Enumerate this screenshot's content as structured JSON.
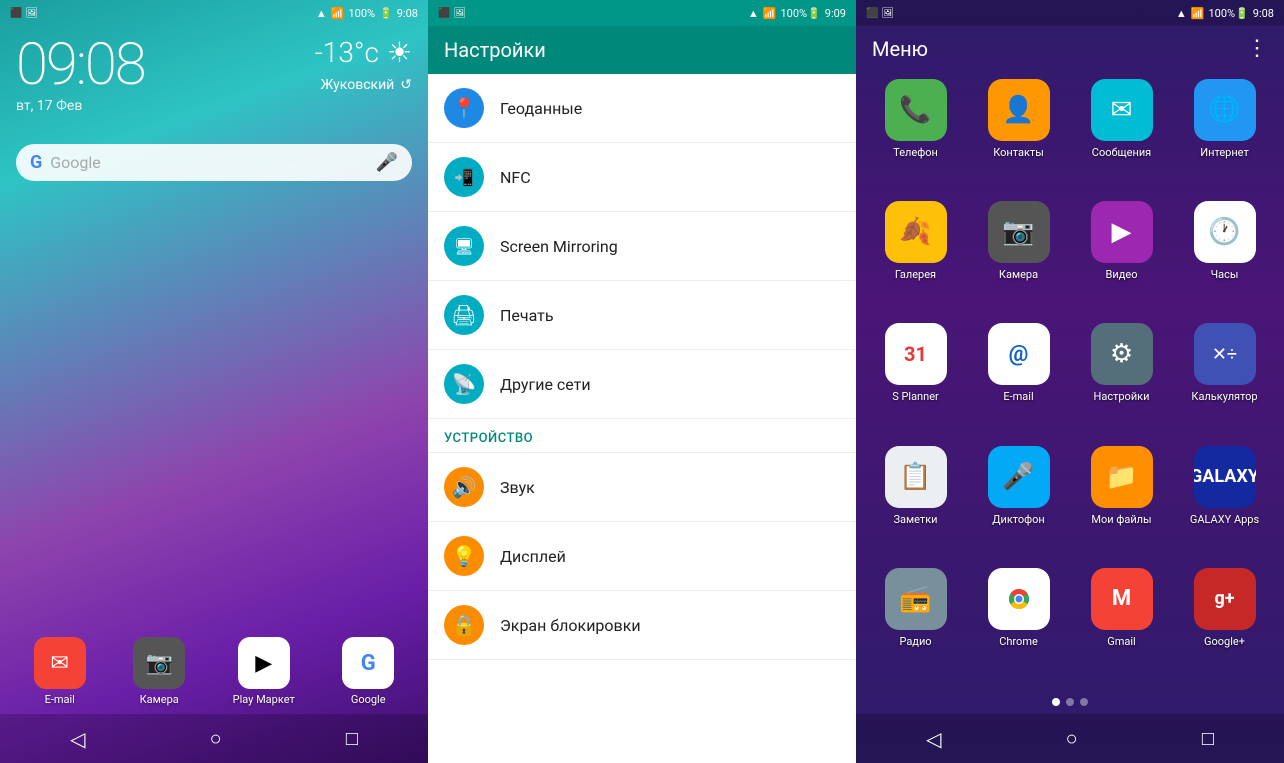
{
  "panel1": {
    "status": {
      "signal": "📶",
      "battery": "100%",
      "time": "9:08"
    },
    "clock": {
      "time": "09:08",
      "date": "вт, 17 Фев"
    },
    "weather": {
      "temp": "-13°с",
      "location": "Жуковский"
    },
    "search": {
      "placeholder": "Google"
    },
    "dock": [
      {
        "label": "E-mail",
        "icon": "✉",
        "bg": "bg-red",
        "name": "email-dock"
      },
      {
        "label": "Камера",
        "icon": "📷",
        "bg": "bg-gray",
        "name": "camera-dock"
      },
      {
        "label": "Play\nМаркет",
        "icon": "▶",
        "bg": "bg-white",
        "name": "play-dock"
      },
      {
        "label": "Google",
        "icon": "G",
        "bg": "bg-white",
        "name": "google-dock"
      }
    ],
    "nav": [
      "◁",
      "○",
      "□"
    ]
  },
  "panel2": {
    "status": {
      "time": "9:09"
    },
    "header": "Настройки",
    "items": [
      {
        "label": "Геоданные",
        "icon": "📍",
        "iconBg": "icon-blue",
        "name": "geodata-item"
      },
      {
        "label": "NFC",
        "icon": "📲",
        "iconBg": "icon-teal",
        "name": "nfc-item"
      },
      {
        "label": "Screen Mirroring",
        "icon": "🖥",
        "iconBg": "icon-teal",
        "name": "screen-mirroring-item"
      },
      {
        "label": "Печать",
        "icon": "🖨",
        "iconBg": "icon-teal",
        "name": "print-item"
      },
      {
        "label": "Другие сети",
        "icon": "📡",
        "iconBg": "icon-teal",
        "name": "other-networks-item"
      }
    ],
    "section": "УСТРОЙСТВО",
    "deviceItems": [
      {
        "label": "Звук",
        "icon": "🔊",
        "iconBg": "icon-orange",
        "name": "sound-item"
      },
      {
        "label": "Дисплей",
        "icon": "💡",
        "iconBg": "icon-orange",
        "name": "display-item"
      },
      {
        "label": "Экран блокировки",
        "icon": "🔒",
        "iconBg": "icon-orange",
        "name": "lockscreen-item"
      }
    ]
  },
  "panel3": {
    "status": {
      "time": "9:08"
    },
    "title": "Меню",
    "apps": [
      {
        "label": "Телефон",
        "icon": "📞",
        "bg": "bg-green",
        "name": "phone-app"
      },
      {
        "label": "Контакты",
        "icon": "👤",
        "bg": "bg-orange",
        "name": "contacts-app"
      },
      {
        "label": "Сообщения",
        "icon": "✉",
        "bg": "bg-teal",
        "name": "messages-app"
      },
      {
        "label": "Интернет",
        "icon": "🌐",
        "bg": "bg-blue",
        "name": "internet-app"
      },
      {
        "label": "Галерея",
        "icon": "🖼",
        "bg": "bg-yellow",
        "name": "gallery-app"
      },
      {
        "label": "Камера",
        "icon": "📷",
        "bg": "bg-gray",
        "name": "camera-app"
      },
      {
        "label": "Видео",
        "icon": "▶",
        "bg": "bg-purple",
        "name": "video-app"
      },
      {
        "label": "Часы",
        "icon": "🕐",
        "bg": "bg-white",
        "name": "clock-app"
      },
      {
        "label": "S Planner",
        "icon": "31",
        "bg": "bg-white",
        "name": "splanner-app"
      },
      {
        "label": "E-mail",
        "icon": "@",
        "bg": "bg-white",
        "name": "email-app"
      },
      {
        "label": "Настройки",
        "icon": "⚙",
        "bg": "bg-white",
        "name": "settings-app"
      },
      {
        "label": "Калькулятор",
        "icon": "🔢",
        "bg": "bg-indigo",
        "name": "calc-app"
      },
      {
        "label": "Заметки",
        "icon": "📝",
        "bg": "bg-white",
        "name": "notes-app"
      },
      {
        "label": "Диктофон",
        "icon": "🎤",
        "bg": "bg-lightblue",
        "name": "recorder-app"
      },
      {
        "label": "Мои файлы",
        "icon": "📁",
        "bg": "bg-amber",
        "name": "files-app"
      },
      {
        "label": "GALAXY Apps",
        "icon": "G",
        "bg": "bg-samsung-blue",
        "name": "galaxy-apps"
      },
      {
        "label": "Радио",
        "icon": "📻",
        "bg": "bg-gray",
        "name": "radio-app"
      },
      {
        "label": "Chrome",
        "icon": "◉",
        "bg": "bg-white",
        "name": "chrome-app"
      },
      {
        "label": "Gmail",
        "icon": "M",
        "bg": "bg-red",
        "name": "gmail-app"
      },
      {
        "label": "Google+",
        "icon": "g+",
        "bg": "bg-red",
        "name": "googleplus-app"
      }
    ],
    "dots": [
      true,
      false,
      false
    ],
    "nav": [
      "◁",
      "○",
      "□"
    ]
  }
}
